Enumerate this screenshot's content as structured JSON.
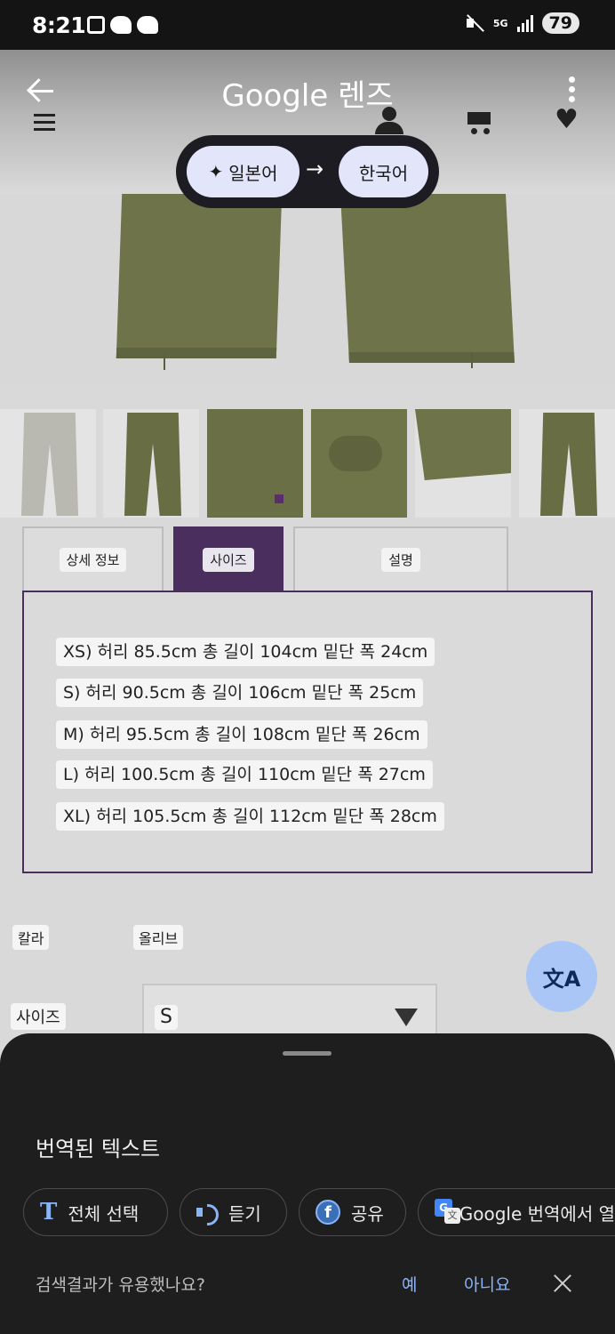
{
  "status_bar": {
    "time": "8:21",
    "network": "5G",
    "battery": "79"
  },
  "lens": {
    "title": "Google 렌즈",
    "source_lang": "일본어",
    "target_lang": "한국어",
    "arrow": "→"
  },
  "tabs": [
    {
      "label": "상세 정보",
      "active": false
    },
    {
      "label": "사이즈",
      "active": true
    },
    {
      "label": "설명",
      "active": false
    }
  ],
  "sizes": [
    "XS) 허리 85.5cm 총 길이 104cm 밑단 폭 24cm",
    "S) 허리 90.5cm 총 길이 106cm 밑단 폭 25cm",
    "M) 허리 95.5cm 총 길이 108cm 밑단 폭 26cm",
    "L) 허리 100.5cm 총 길이 110cm 밑단 폭 27cm",
    "XL) 허리 105.5cm 총 길이 112cm 밑단 폭 28cm"
  ],
  "attributes": {
    "color_label": "칼라",
    "color_value": "올리브",
    "size_label": "사이즈",
    "size_value": "S"
  },
  "sheet": {
    "title": "번역된 텍스트",
    "actions": {
      "select_all": "전체 선택",
      "listen": "듣기",
      "share": "공유",
      "google_translate": "Google 번역에서 열"
    },
    "feedback_question": "검색결과가 유용했나요?",
    "yes": "예",
    "no": "아니요"
  },
  "icons": [
    "back-arrow-icon",
    "more-vert-icon",
    "menu-icon",
    "user-icon",
    "cart-icon",
    "heart-icon",
    "sparkle-icon",
    "translate-icon",
    "text-select-icon",
    "speaker-icon",
    "share-icon",
    "google-translate-icon",
    "close-icon"
  ],
  "colors": {
    "accent_purple": "#4a2e5e",
    "sheet_bg": "#1e1e1e",
    "link_blue": "#8ab4f8",
    "fab_bg": "#a9c6f7",
    "olive": "#6e7349"
  }
}
